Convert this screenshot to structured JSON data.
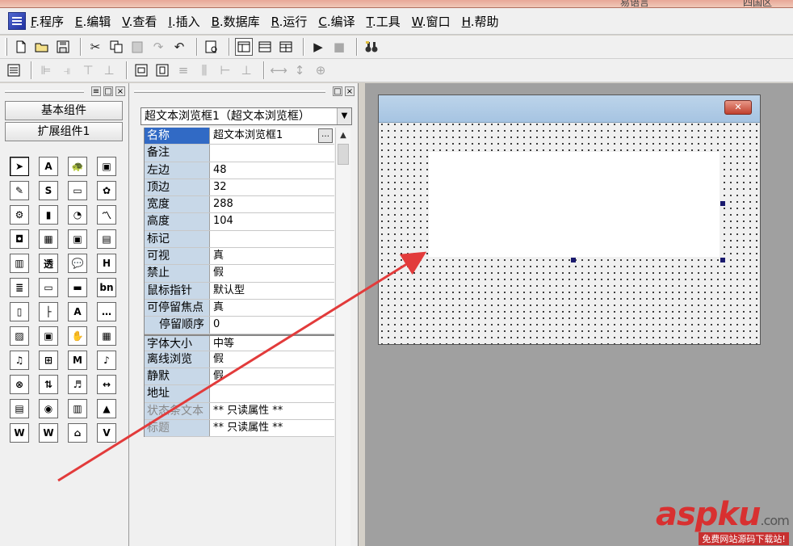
{
  "window": {
    "title_left": "易语言",
    "title_right": "四国区"
  },
  "menu": [
    {
      "key": "F",
      "label": ".程序"
    },
    {
      "key": "E",
      "label": ".编辑"
    },
    {
      "key": "V",
      "label": ".查看"
    },
    {
      "key": "I",
      "label": ".插入"
    },
    {
      "key": "B",
      "label": ".数据库"
    },
    {
      "key": "R",
      "label": ".运行"
    },
    {
      "key": "C",
      "label": ".编译"
    },
    {
      "key": "T",
      "label": ".工具"
    },
    {
      "key": "W",
      "label": ".窗口"
    },
    {
      "key": "H",
      "label": ".帮助"
    }
  ],
  "palette": {
    "tab_basic": "基本组件",
    "tab_extended": "扩展组件1",
    "icons": [
      "pointer-icon",
      "label-icon",
      "turtle-icon",
      "picture-box-icon",
      "edit-box-icon",
      "sock-icon",
      "button-icon",
      "palette-icon",
      "animation-icon",
      "bar-chart-icon",
      "pie-chart-icon",
      "line-chart-icon",
      "data-source-icon",
      "table-icon",
      "grid-icon",
      "calendar-icon",
      "spreadsheet-icon",
      "transparent-label-icon",
      "speech-bubble-icon",
      "html-browser-icon",
      "list-icon",
      "tab-icon",
      "progress-icon",
      "bn-icon",
      "book-icon",
      "tree-icon",
      "text-style-icon",
      "ellipsis-icon",
      "image-icon",
      "layer-icon",
      "drag-icon",
      "frame-icon",
      "audio-icon",
      "selector-icon",
      "midi-icon",
      "sound-icon",
      "network-icon",
      "upload-icon",
      "midi-device-icon",
      "cn-input-icon",
      "report-icon",
      "hypertext-browser-icon",
      "doc-frame-icon",
      "shapes-icon",
      "word-icon",
      "wps-icon",
      "scanner-icon",
      "vcl-icon"
    ]
  },
  "properties": {
    "object_select": "超文本浏览框1（超文本浏览框）",
    "rows": [
      {
        "key": "名称",
        "value": "超文本浏览框1"
      },
      {
        "key": "备注",
        "value": ""
      },
      {
        "key": "左边",
        "value": "48"
      },
      {
        "key": "顶边",
        "value": "32"
      },
      {
        "key": "宽度",
        "value": "288"
      },
      {
        "key": "高度",
        "value": "104"
      },
      {
        "key": "标记",
        "value": ""
      },
      {
        "key": "可视",
        "value": "真"
      },
      {
        "key": "禁止",
        "value": "假"
      },
      {
        "key": "鼠标指针",
        "value": "默认型"
      },
      {
        "key": "可停留焦点",
        "value": "真"
      },
      {
        "key": "停留顺序",
        "value": "0"
      },
      {
        "key": "字体大小",
        "value": "中等"
      },
      {
        "key": "离线浏览",
        "value": "假"
      },
      {
        "key": "静默",
        "value": "假"
      },
      {
        "key": "地址",
        "value": ""
      },
      {
        "key": "状态条文本",
        "value": "** 只读属性 **"
      },
      {
        "key": "标题",
        "value": "** 只读属性 **"
      }
    ],
    "ellipsis": "…"
  },
  "form": {
    "close_label": "✕"
  },
  "watermark": {
    "brand": "aspku",
    "tld": ".com",
    "tagline": "免费网站源码下载站!"
  },
  "colors": {
    "selected_row": "#316ac5",
    "property_key_bg": "#c8d8e8",
    "annotation_arrow": "#e23b3b"
  }
}
